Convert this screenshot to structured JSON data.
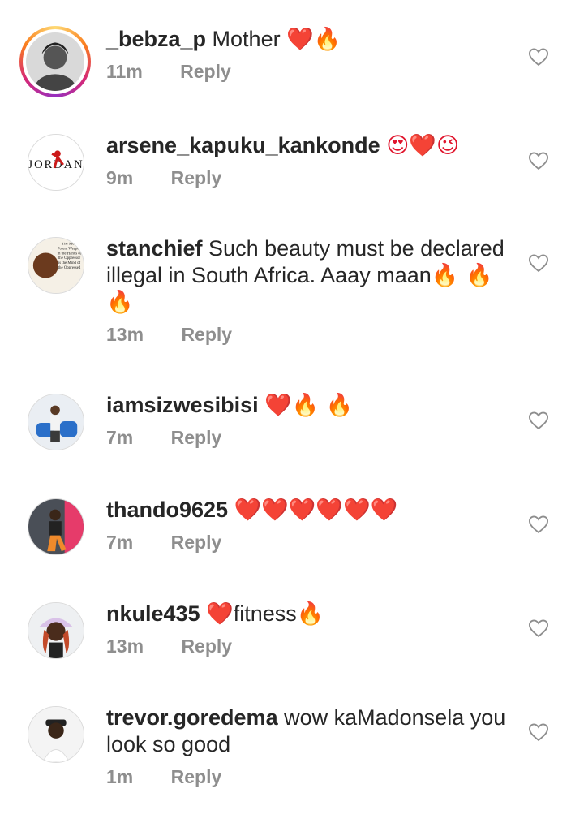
{
  "comments": [
    {
      "username": "_bebza_p",
      "text": " Mother ",
      "emoji": "❤️🔥",
      "time": "11m",
      "reply": "Reply"
    },
    {
      "username": "arsene_kapuku_kankonde",
      "text": " ",
      "emoji": "😍❤️😉",
      "time": "9m",
      "reply": "Reply",
      "avatar_text": "JORDAN"
    },
    {
      "username": "stanchief",
      "text": " Such beauty must be declared illegal in South Africa.  Aaay maan",
      "emoji": "🔥 🔥 🔥",
      "time": "13m",
      "reply": "Reply",
      "avatar_text": "The Most Potent Weapon in the Hands of the Oppressor is the Mind of the Oppressed"
    },
    {
      "username": "iamsizwesibisi",
      "text": " ",
      "emoji": "❤️🔥 🔥",
      "time": "7m",
      "reply": "Reply"
    },
    {
      "username": "thando9625",
      "text": " ",
      "emoji": "❤️❤️❤️❤️❤️❤️",
      "time": "7m",
      "reply": "Reply"
    },
    {
      "username": "nkule435",
      "text": " ",
      "emoji": "❤️",
      "text2": "fitness",
      "emoji2": "🔥",
      "time": "13m",
      "reply": "Reply"
    },
    {
      "username": "trevor.goredema",
      "text": " wow kaMadonsela you look so good",
      "emoji": "",
      "time": "1m",
      "reply": "Reply"
    }
  ],
  "icons": {
    "like": "heart-outline-icon"
  },
  "colors": {
    "text": "#262626",
    "meta": "#8e8e8e",
    "heart": "#e0142c",
    "fire": "#f7931e"
  }
}
